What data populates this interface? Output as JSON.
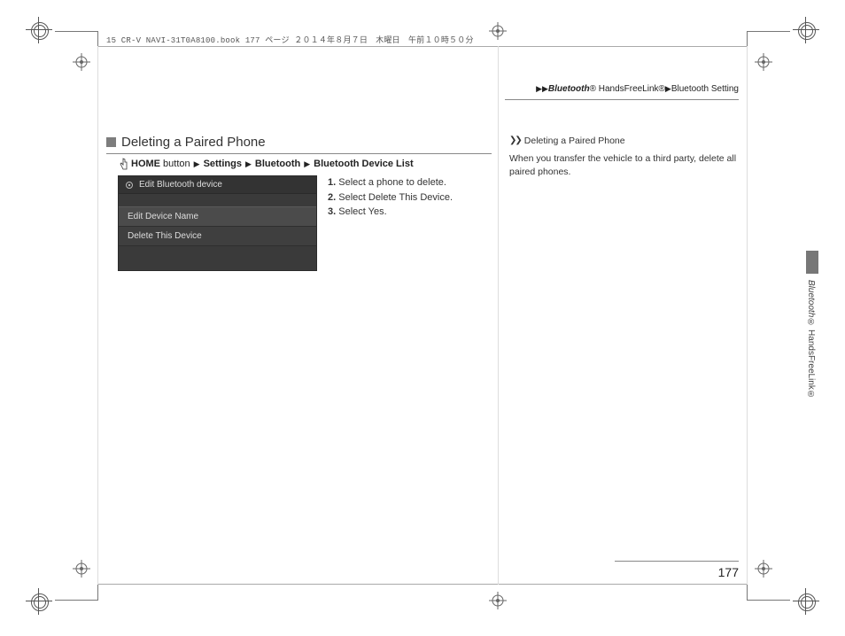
{
  "file_header": "15 CR-V NAVI-31T0A8100.book  177 ページ  ２０１４年８月７日　木曜日　午前１０時５０分",
  "breadcrumb": {
    "b1_em": "Bluetooth",
    "b1_sup": "®",
    "b2": "HandsFreeLink",
    "b2_sup": "®",
    "b3": "Bluetooth Setting"
  },
  "section": {
    "title": "Deleting a Paired Phone",
    "nav": {
      "home_bold": "HOME",
      "home_rest": " button",
      "settings": "Settings",
      "bluetooth": "Bluetooth",
      "device_list": "Bluetooth Device List"
    },
    "screenshot": {
      "header": "Edit Bluetooth device",
      "rows": [
        "Edit Device Name",
        "Delete This Device"
      ]
    },
    "steps": {
      "s1_pre": "1. ",
      "s1": "Select a phone to delete.",
      "s2_pre": "2. ",
      "s2_a": "Select ",
      "s2_b": "Delete This Device",
      "s2_c": ".",
      "s3_pre": "3. ",
      "s3_a": "Select ",
      "s3_b": "Yes",
      "s3_c": "."
    }
  },
  "sidebar": {
    "title": "Deleting a Paired Phone",
    "body": "When you transfer the vehicle to a third party, delete all paired phones."
  },
  "vtab": {
    "a_em": "Bluetooth",
    "b": "® HandsFreeLink®"
  },
  "page_number": "177"
}
